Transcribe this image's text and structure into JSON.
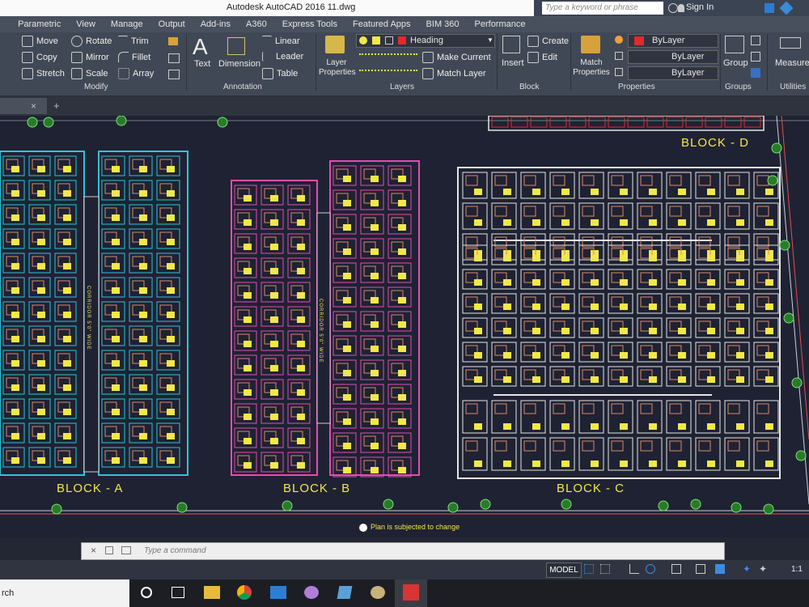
{
  "window": {
    "title": "Autodesk AutoCAD 2016    11.dwg"
  },
  "search": {
    "placeholder": "Type a keyword or phrase"
  },
  "account": {
    "signin": "Sign In"
  },
  "tabs": [
    "Parametric",
    "View",
    "Manage",
    "Output",
    "Add-ins",
    "A360",
    "Express Tools",
    "Featured Apps",
    "BIM 360",
    "Performance"
  ],
  "ribbon": {
    "modify": {
      "title": "Modify",
      "move": "Move",
      "rotate": "Rotate",
      "trim": "Trim",
      "copy": "Copy",
      "mirror": "Mirror",
      "fillet": "Fillet",
      "stretch": "Stretch",
      "scale": "Scale",
      "array": "Array"
    },
    "annotation": {
      "title": "Annotation",
      "text": "Text",
      "dimension": "Dimension",
      "linear": "Linear",
      "leader": "Leader",
      "table": "Table"
    },
    "layers": {
      "title": "Layers",
      "layer_properties": "Layer Properties",
      "current_layer": "Heading",
      "make_current": "Make Current",
      "match_layer": "Match Layer"
    },
    "block": {
      "title": "Block",
      "insert": "Insert",
      "create": "Create",
      "edit": "Edit"
    },
    "properties": {
      "title": "Properties",
      "match_properties": "Match Properties",
      "color": "ByLayer",
      "linetype": "ByLayer",
      "lineweight": "ByLayer"
    },
    "groups": {
      "title": "Groups",
      "group": "Group"
    },
    "utilities": {
      "title": "Utilities",
      "measure": "Measure"
    }
  },
  "drawing": {
    "labels": {
      "block_a": "BLOCK - A",
      "block_b": "BLOCK - B",
      "block_c": "BLOCK - C",
      "block_d": "BLOCK - D"
    },
    "corridor_text": "CORRIDOR 5'0\" WIDE",
    "note": "Plan is subjected to change"
  },
  "command": {
    "placeholder": "Type a command"
  },
  "status": {
    "model": "MODEL",
    "scale": "1:1"
  },
  "taskbar": {
    "search": "rch"
  },
  "colors": {
    "yellow": "#f1e84a",
    "cyan": "#2ec4d8",
    "magenta": "#e04fb0",
    "white": "#e6e6e6",
    "red": "#e12b2b"
  }
}
